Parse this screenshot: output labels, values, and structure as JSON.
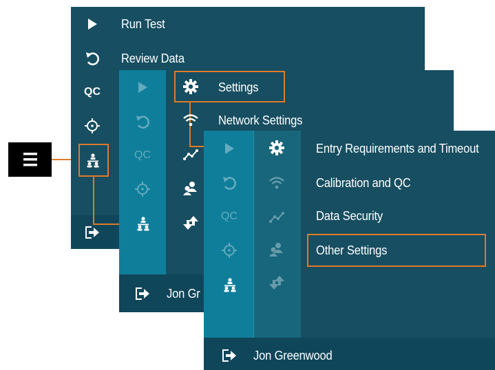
{
  "menu1": {
    "items": [
      {
        "icon": "play-icon",
        "label": "Run Test"
      },
      {
        "icon": "undo-icon",
        "label": "Review Data"
      },
      {
        "icon": "qc-icon",
        "label": "QC"
      },
      {
        "icon": "crosshair-icon",
        "label": ""
      },
      {
        "icon": "org-chart-icon",
        "label": ""
      }
    ],
    "logout_icon": "logout-icon"
  },
  "menu2": {
    "items": [
      {
        "icon": "gear-icon",
        "label": "Settings"
      },
      {
        "icon": "wifi-icon",
        "label": "Network Settings"
      }
    ],
    "rail_qc": "QC",
    "footer_user": "Jon Gr"
  },
  "menu3": {
    "items": [
      {
        "icon": "gear-icon",
        "label": "Entry Requirements and Timeout"
      },
      {
        "icon": "wifi-icon",
        "label": "Calibration and QC"
      },
      {
        "icon": "chart-line-icon",
        "label": "Data Security"
      },
      {
        "icon": "users-icon",
        "label": "Other Settings"
      }
    ],
    "rail_qc": "QC",
    "footer_user": "Jon Greenwood"
  },
  "hamburger_icon": "hamburger-menu-icon",
  "colors": {
    "panel": "#174e61",
    "rail": "#0f7e9b",
    "highlight": "#e07b27",
    "hamburger_bg": "#000000"
  }
}
